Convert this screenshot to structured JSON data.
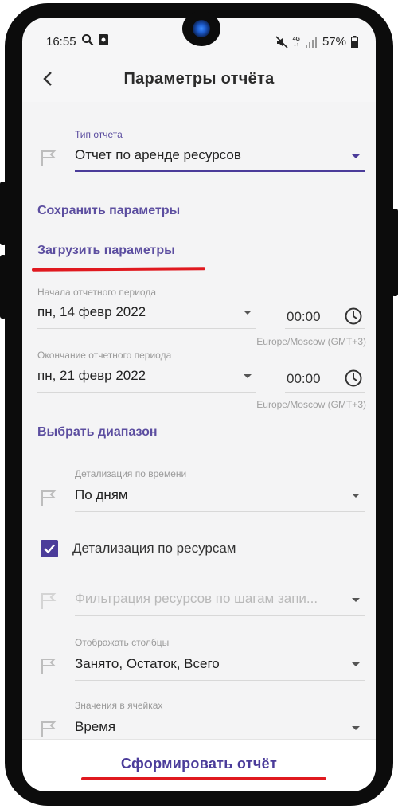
{
  "status_bar": {
    "time": "16:55",
    "network": "4G",
    "battery": "57%",
    "icons": [
      "search-icon",
      "photo-icon",
      "mute-icon",
      "signal-icon",
      "battery-icon"
    ]
  },
  "app_bar": {
    "title": "Параметры отчёта"
  },
  "report_type": {
    "label": "Тип отчета",
    "value": "Отчет по аренде ресурсов"
  },
  "actions": {
    "save": "Сохранить параметры",
    "load": "Загрузить параметры",
    "choose_range": "Выбрать диапазон"
  },
  "period_start": {
    "label": "Начала отчетного периода",
    "date": "пн, 14 февр 2022",
    "time": "00:00",
    "timezone": "Europe/Moscow (GMT+3)"
  },
  "period_end": {
    "label": "Окончание отчетного периода",
    "date": "пн, 21 февр 2022",
    "time": "00:00",
    "timezone": "Europe/Moscow (GMT+3)"
  },
  "time_detail": {
    "label": "Детализация по времени",
    "value": "По дням"
  },
  "resource_detail": {
    "label": "Детализация по ресурсам",
    "checked": true
  },
  "resource_filter": {
    "placeholder": "Фильтрация ресурсов по шагам запи..."
  },
  "columns": {
    "label": "Отображать столбцы",
    "value": "Занято, Остаток, Всего"
  },
  "cell_values": {
    "label": "Значения в ячейках",
    "value": "Время"
  },
  "footer": {
    "generate": "Сформировать отчёт"
  },
  "colors": {
    "accent": "#4b3c9a",
    "link": "#5c4ea0",
    "highlight": "#e0191f"
  }
}
